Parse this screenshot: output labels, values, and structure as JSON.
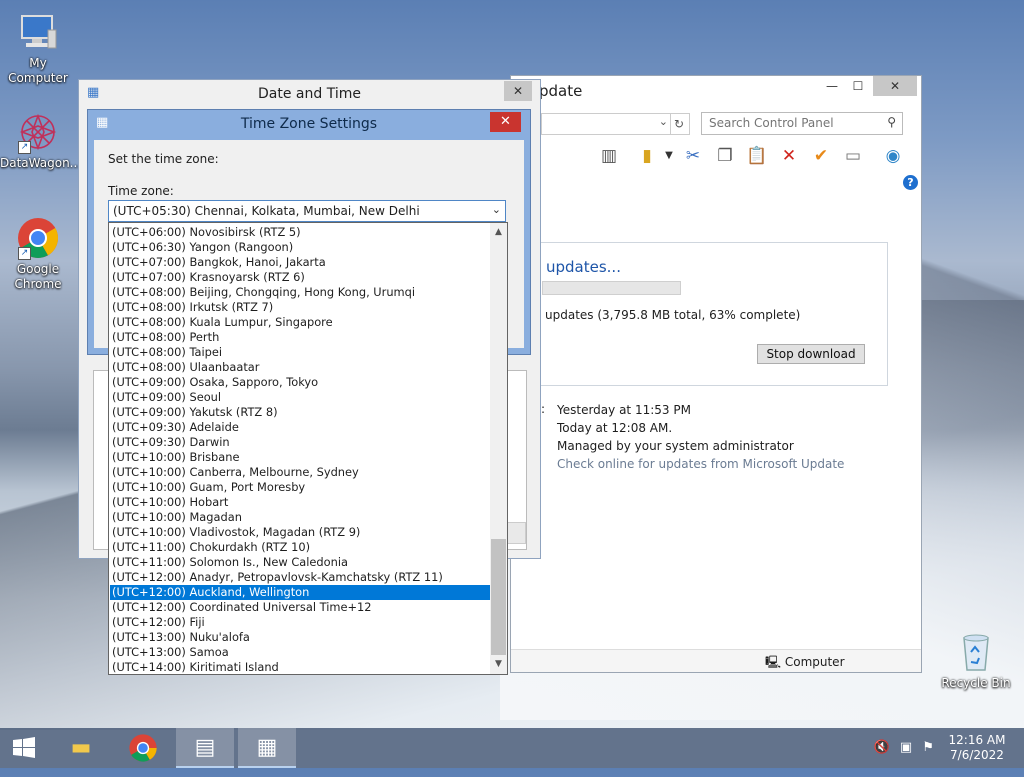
{
  "desktop": {
    "icons": [
      {
        "label": "My Computer"
      },
      {
        "label": "DataWagon..."
      },
      {
        "label": "Google Chrome"
      },
      {
        "label": "Recycle Bin"
      }
    ]
  },
  "control_panel": {
    "title_partial": "pdate",
    "search_placeholder": "Search Control Panel",
    "wu_heading": "updates...",
    "wu_progress_percent": 63,
    "wu_status": "updates (3,795.8 MB total, 63% complete)",
    "stop_button": "Stop download",
    "info_lines": [
      "Yesterday at 11:53 PM",
      "Today at 12:08 AM.",
      "Managed by your system administrator"
    ],
    "info_link": "Check online for updates from Microsoft Update",
    "status_computer": "Computer"
  },
  "date_time": {
    "title": "Date and Time"
  },
  "timezone_settings": {
    "title": "Time Zone Settings",
    "set_label": "Set the time zone:",
    "tz_label": "Time zone:",
    "selected": "(UTC+05:30) Chennai, Kolkata, Mumbai, New Delhi",
    "highlighted": "(UTC+12:00) Auckland, Wellington",
    "options": [
      "(UTC+06:00) Novosibirsk (RTZ 5)",
      "(UTC+06:30) Yangon (Rangoon)",
      "(UTC+07:00) Bangkok, Hanoi, Jakarta",
      "(UTC+07:00) Krasnoyarsk (RTZ 6)",
      "(UTC+08:00) Beijing, Chongqing, Hong Kong, Urumqi",
      "(UTC+08:00) Irkutsk (RTZ 7)",
      "(UTC+08:00) Kuala Lumpur, Singapore",
      "(UTC+08:00) Perth",
      "(UTC+08:00) Taipei",
      "(UTC+08:00) Ulaanbaatar",
      "(UTC+09:00) Osaka, Sapporo, Tokyo",
      "(UTC+09:00) Seoul",
      "(UTC+09:00) Yakutsk (RTZ 8)",
      "(UTC+09:30) Adelaide",
      "(UTC+09:30) Darwin",
      "(UTC+10:00) Brisbane",
      "(UTC+10:00) Canberra, Melbourne, Sydney",
      "(UTC+10:00) Guam, Port Moresby",
      "(UTC+10:00) Hobart",
      "(UTC+10:00) Magadan",
      "(UTC+10:00) Vladivostok, Magadan (RTZ 9)",
      "(UTC+11:00) Chokurdakh (RTZ 10)",
      "(UTC+11:00) Solomon Is., New Caledonia",
      "(UTC+12:00) Anadyr, Petropavlovsk-Kamchatsky (RTZ 11)",
      "(UTC+12:00) Auckland, Wellington",
      "(UTC+12:00) Coordinated Universal Time+12",
      "(UTC+12:00) Fiji",
      "(UTC+13:00) Nuku'alofa",
      "(UTC+13:00) Samoa",
      "(UTC+14:00) Kiritimati Island"
    ]
  },
  "taskbar": {
    "time": "12:16 AM",
    "date": "7/6/2022"
  },
  "colors": {
    "selection": "#0078d7",
    "tz_frame": "#8aaede",
    "close_red": "#c9342f"
  }
}
